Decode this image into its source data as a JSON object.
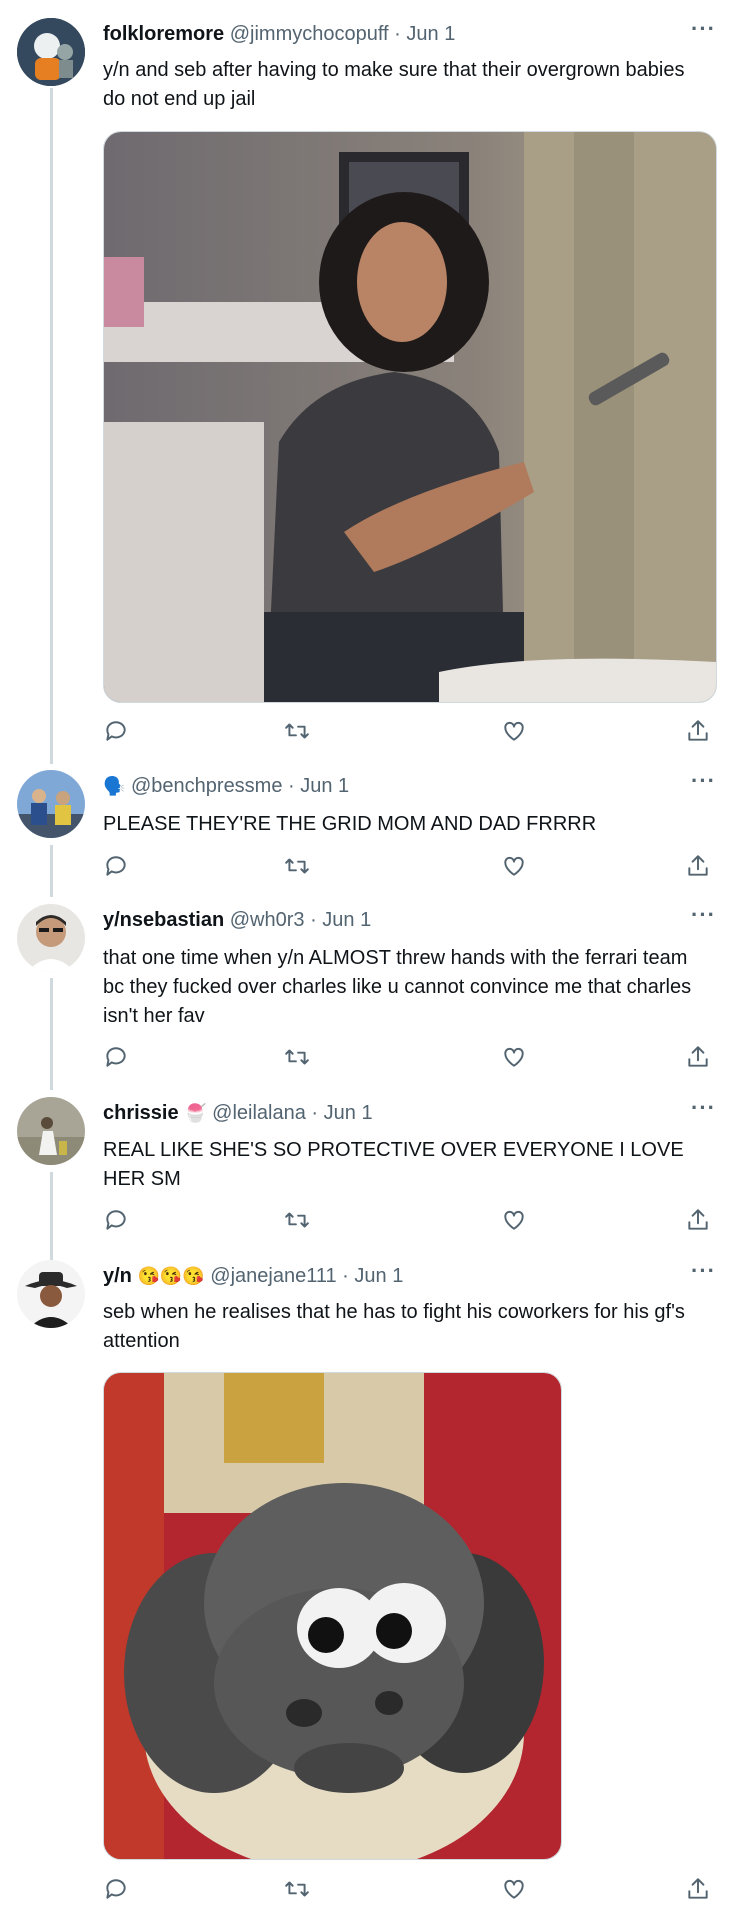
{
  "tweets": [
    {
      "name": "folkloremore",
      "handle": "@jimmychocopuff",
      "date": "Jun 1",
      "text": "y/n and seb after having to make sure that their overgrown babies do not end up jail",
      "has_media": true
    },
    {
      "name": "",
      "name_emoji": "🗣️",
      "handle": "@benchpressme",
      "date": "Jun 1",
      "text": "PLEASE THEY'RE THE GRID MOM AND DAD FRRRR",
      "has_media": false
    },
    {
      "name": "y/nsebastian",
      "handle": "@wh0r3",
      "date": "Jun 1",
      "text": "that one time when y/n ALMOST threw hands with the ferrari team bc they fucked over charles like u cannot convince me that charles isn't her fav",
      "has_media": false
    },
    {
      "name": "chrissie",
      "name_emoji": "🍧",
      "handle": "@leilalana",
      "date": "Jun 1",
      "text": "REAL LIKE SHE'S SO PROTECTIVE OVER EVERYONE I LOVE HER SM",
      "has_media": false
    },
    {
      "name": "y/n",
      "name_emoji": "😘😘😘",
      "handle": "@janejane111",
      "date": "Jun 1",
      "text": "seb when he realises that he has to fight his coworkers for his gf's attention",
      "has_media": true
    }
  ],
  "ui": {
    "separator": " · ",
    "more_label": "···",
    "icons": [
      "reply-icon",
      "retweet-icon",
      "like-icon",
      "share-icon"
    ]
  },
  "colors": {
    "thread_line": "#cfd9de",
    "secondary_text": "#536471",
    "primary_text": "#0f1419"
  }
}
